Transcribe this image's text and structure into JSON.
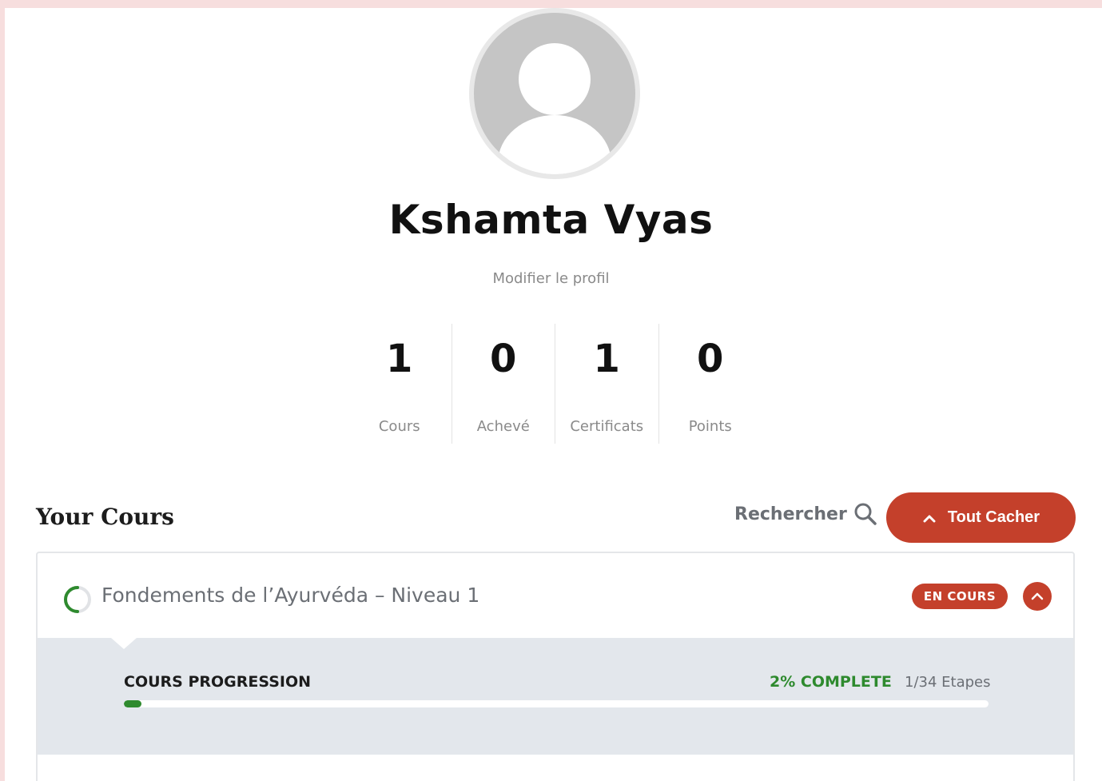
{
  "profile": {
    "name": "Kshamta Vyas",
    "edit_label": "Modifier le profil"
  },
  "stats": [
    {
      "value": "1",
      "label": "Cours"
    },
    {
      "value": "0",
      "label": "Achevé"
    },
    {
      "value": "1",
      "label": "Certificats"
    },
    {
      "value": "0",
      "label": "Points"
    }
  ],
  "courses_section": {
    "title": "Your Cours",
    "search_label": "Rechercher",
    "collapse_all_label": "Tout Cacher"
  },
  "course": {
    "name": "Fondements de l’Ayurvéda – Niveau 1",
    "status": "EN COURS",
    "progress_title": "COURS PROGRESSION",
    "progress_percent_label": "2% COMPLETE",
    "progress_fraction": 0.02,
    "steps_label": "1/34 Etapes"
  },
  "colors": {
    "accent": "#c4402b",
    "success": "#2e8a2e",
    "muted": "#6b6f75"
  },
  "icons": {
    "avatar": "avatar-placeholder-icon",
    "search": "search-icon",
    "collapse": "chevron-up-icon",
    "progress": "progress-ring-icon"
  }
}
